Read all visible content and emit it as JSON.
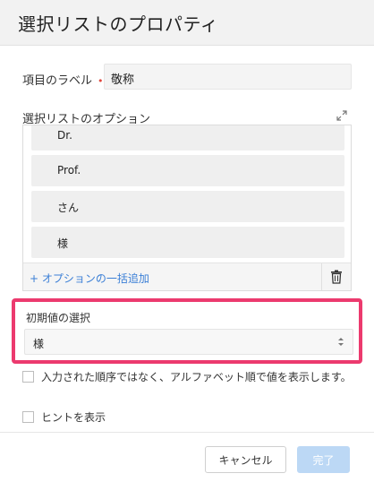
{
  "dialog": {
    "title": "選択リストのプロパティ"
  },
  "field_label": {
    "label": "項目のラベル",
    "required_mark": "•",
    "value": "敬称"
  },
  "options": {
    "label": "選択リストのオプション",
    "expand_icon": "expand-icon",
    "items": [
      "Dr.",
      "Prof.",
      "さん",
      "様"
    ],
    "bulk_add": "+ オプションの一括追加",
    "delete_icon": "trash-icon"
  },
  "default_value": {
    "label": "初期値の選択",
    "selected": "様",
    "highlight_color": "#ec3a6e"
  },
  "checkboxes": {
    "alphabetical": "入力された順序ではなく、アルファベット順で値を表示します。",
    "show_hint": "ヒントを表示"
  },
  "footer": {
    "cancel": "キャンセル",
    "done": "完了"
  }
}
